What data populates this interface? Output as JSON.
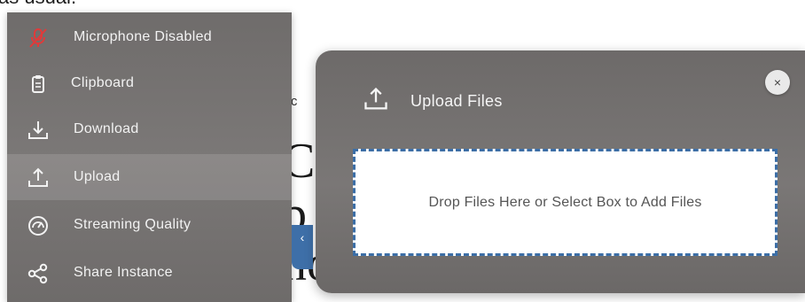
{
  "background": {
    "top_text": "as usual.",
    "small_text": "okc",
    "line1": "Co",
    "line2": "b",
    "line3": "no p"
  },
  "menu": {
    "items": [
      {
        "label": "Microphone Disabled",
        "icon": "microphone-disabled-icon"
      },
      {
        "label": "Clipboard",
        "icon": "clipboard-icon"
      },
      {
        "label": "Download",
        "icon": "download-icon"
      },
      {
        "label": "Upload",
        "icon": "upload-icon",
        "active": true
      },
      {
        "label": "Streaming Quality",
        "icon": "gauge-icon"
      },
      {
        "label": "Share Instance",
        "icon": "share-icon"
      }
    ]
  },
  "collapse_tab": {
    "glyph": "‹"
  },
  "dialog": {
    "title": "Upload Files",
    "close_glyph": "×",
    "dropzone_text": "Drop Files Here or Select Box to Add Files"
  },
  "colors": {
    "accent": "#3c6ea6",
    "mic_disabled": "#e03a3a",
    "panel_bg": "#767372"
  }
}
